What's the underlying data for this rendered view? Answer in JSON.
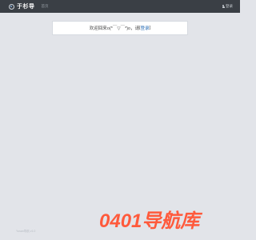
{
  "header": {
    "logo_text": "于杉导",
    "nav_home": "首页",
    "login_label": "登录"
  },
  "welcome": {
    "prefix": "欢迎回来",
    "kaomoji": "o(*￣▽￣*)o",
    "suffix": "，请",
    "bracket_open": "[",
    "login_link": "登录",
    "bracket_close": "]"
  },
  "footer": {
    "text": "Yusan导航 v1.0"
  },
  "watermark": {
    "text": "0401导航库",
    "color": "#ff5a3c"
  },
  "colors": {
    "topbar": "#3a3f45",
    "background": "#e2e4e9",
    "link": "#2a6db5"
  }
}
